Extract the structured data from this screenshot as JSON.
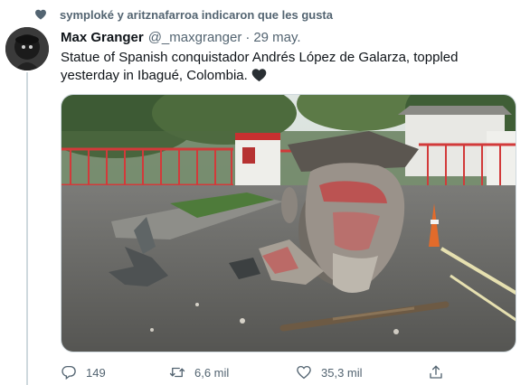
{
  "social_context": {
    "text": "symploké y aritznafarroa indicaron que les gusta",
    "icon": "heart-icon"
  },
  "tweet": {
    "author_name": "Max Granger",
    "author_handle": "@_maxgranger",
    "separator": "·",
    "date": "29 may.",
    "text": "Statue of Spanish conquistador Andrés López de Galarza, toppled yesterday in Ibagué, Colombia.",
    "text_emoji": "black-heart-emoji",
    "media": {
      "description_icon": "photo-statue-toppled"
    }
  },
  "actions": {
    "reply": {
      "icon": "reply-icon",
      "count": "149"
    },
    "retweet": {
      "icon": "retweet-icon",
      "count": "6,6 mil"
    },
    "like": {
      "icon": "like-icon",
      "count": "35,3 mil"
    },
    "share": {
      "icon": "share-icon"
    }
  },
  "colors": {
    "secondary_text": "#536471",
    "primary_text": "#0f1419",
    "border": "#cfd9de"
  }
}
